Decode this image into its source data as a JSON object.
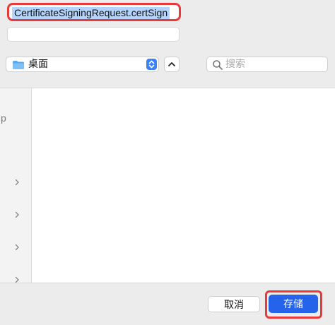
{
  "dialog": {
    "filename": "CertificateSigningRequest.certSign",
    "tags_value": "",
    "location_label": "桌面",
    "search_placeholder": "搜索",
    "sidebar_partial_letter": "p",
    "cancel_label": "取消",
    "save_label": "存储"
  },
  "colors": {
    "accent_blue": "#2563eb",
    "highlight_red": "#e53b3b"
  },
  "icons": {
    "location": "folder-icon",
    "stepper": "updown-stepper-icon",
    "expand": "chevron-up-icon",
    "search": "magnifier-icon",
    "sidebar_disclosure": "chevron-right-icon"
  }
}
